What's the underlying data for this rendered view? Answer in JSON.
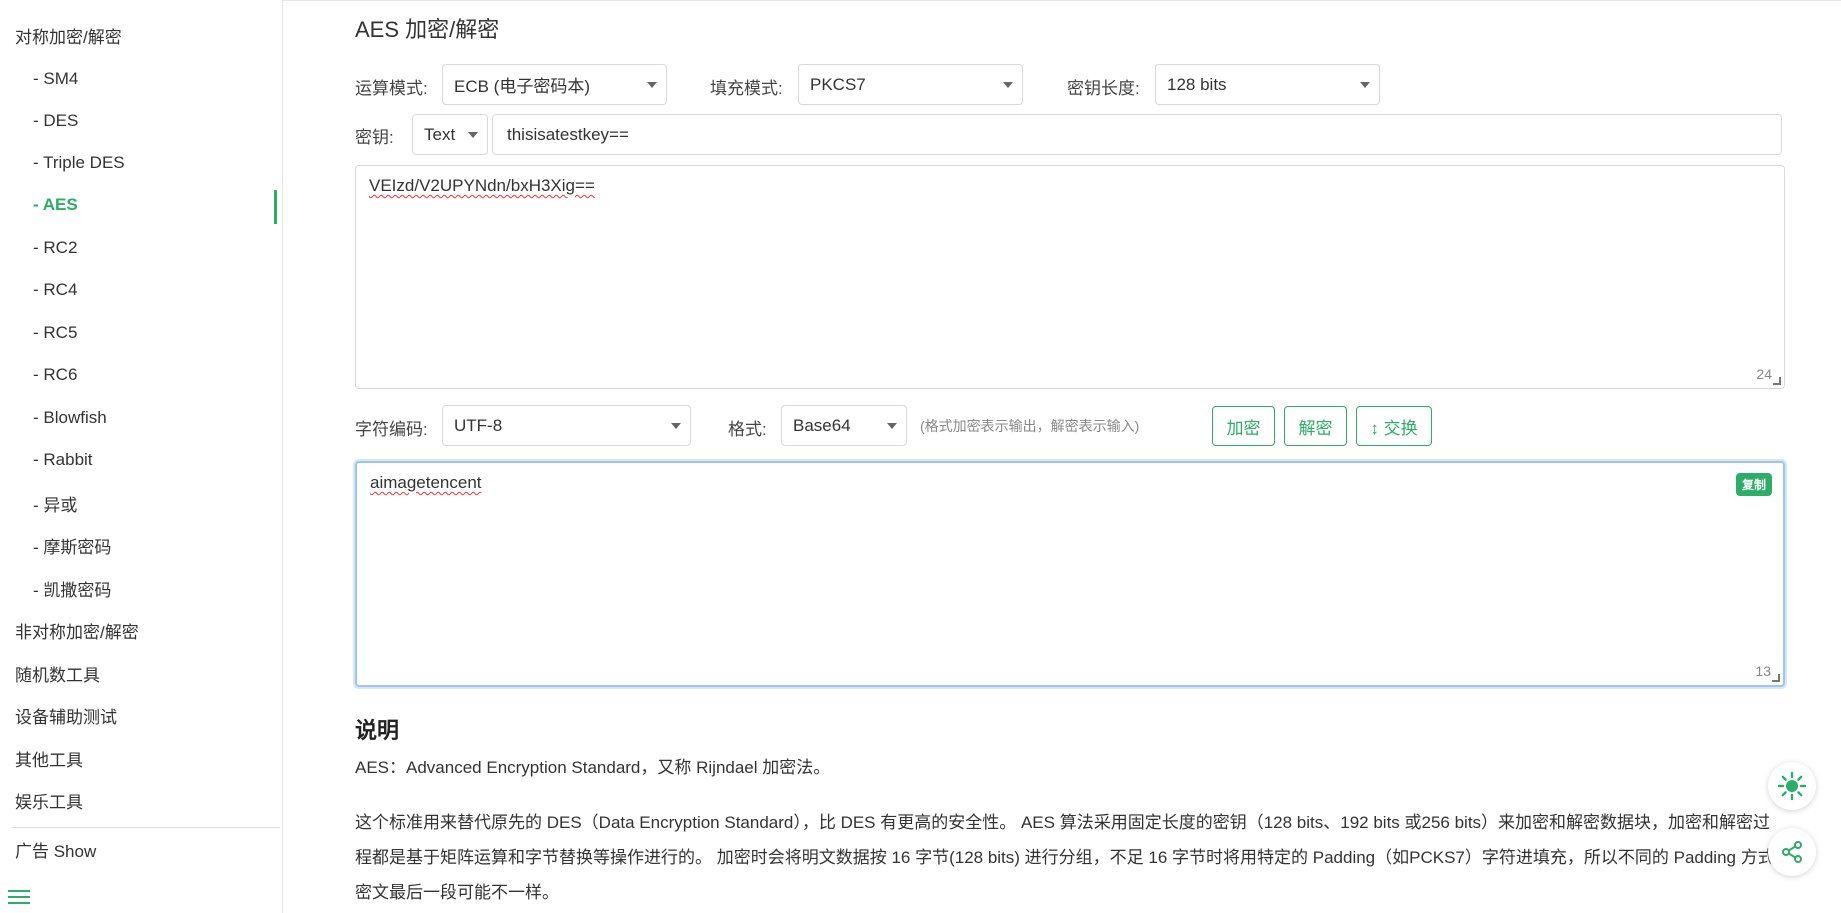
{
  "sidebar": {
    "categories_top": [
      "对称加密/解密"
    ],
    "sub_items": [
      "- SM4",
      "- DES",
      "- Triple DES",
      "- AES",
      "- RC2",
      "- RC4",
      "- RC5",
      "- RC6",
      "- Blowfish",
      "- Rabbit",
      "- 异或",
      "- 摩斯密码",
      "- 凯撒密码"
    ],
    "active_index": 3,
    "categories_bottom": [
      "非对称加密/解密",
      "随机数工具",
      "设备辅助测试",
      "其他工具",
      "娱乐工具"
    ],
    "ad": "广告 Show"
  },
  "main": {
    "title": "AES 加密/解密",
    "mode_label": "运算模式:",
    "mode_value": "ECB (电子密码本)",
    "padding_label": "填充模式:",
    "padding_value": "PKCS7",
    "keylen_label": "密钥长度:",
    "keylen_value": "128 bits",
    "key_label": "密钥:",
    "key_type": "Text",
    "key_value": "thisisatestkey==",
    "input_text": "VEIzd/V2UPYNdn/bxH3Xig==",
    "input_count": "24",
    "charset_label": "字符编码:",
    "charset_value": "UTF-8",
    "format_label": "格式:",
    "format_value": "Base64",
    "format_hint": "(格式加密表示输出，解密表示输入)",
    "encrypt_btn": "加密",
    "decrypt_btn": "解密",
    "swap_btn": "↕ 交换",
    "output_text": "aimagetencent",
    "output_count": "13",
    "copy_label": "复制",
    "desc_title": "说明",
    "desc_line1": "AES：Advanced Encryption Standard，又称 Rijndael 加密法。",
    "desc_para": "这个标准用来替代原先的 DES（Data Encryption Standard），比 DES 有更高的安全性。 AES 算法采用固定长度的密钥（128 bits、192 bits 或256 bits）来加密和解密数据块，加密和解密过程都是基于矩阵运算和字节替换等操作进行的。 加密时会将明文数据按 16 字节(128 bits) 进行分组，不足 16 字节时将用特定的 Padding（如PCKS7）字符进填充，所以不同的 Padding 方式密文最后一段可能不一样。"
  },
  "colors": {
    "accent": "#2bae67"
  },
  "icons": {
    "theme": "sun-icon",
    "share": "share-icon",
    "menu": "hamburger-icon"
  }
}
